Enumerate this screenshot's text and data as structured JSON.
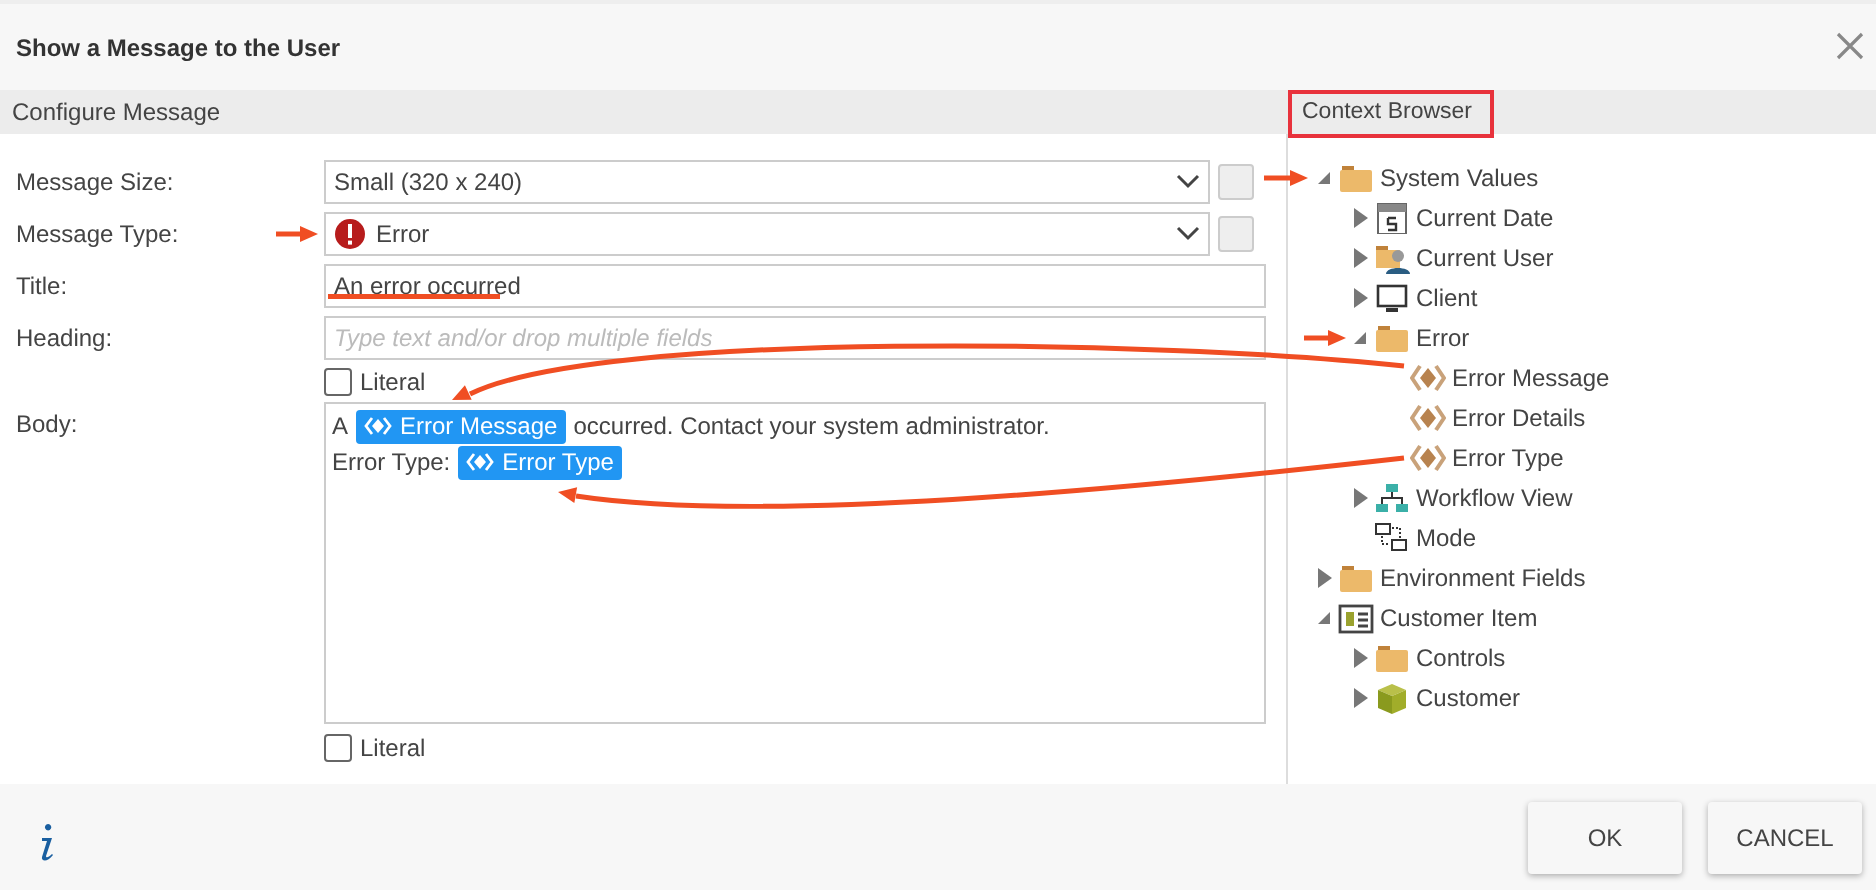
{
  "window": {
    "title": "Show a Message to the User"
  },
  "configure": {
    "heading": "Configure Message",
    "fields": [
      {
        "kind": "select",
        "label": "Message Size:",
        "value": "Small (320 x 240)"
      },
      {
        "kind": "select",
        "label": "Message Type:",
        "value": "Error",
        "status_icon": true
      },
      {
        "kind": "text",
        "label": "Title:",
        "value": "An error occurred"
      },
      {
        "kind": "text",
        "label": "Heading:",
        "placeholder": "Type text and/or drop multiple fields",
        "literal": {
          "label": "Literal",
          "checked": false
        }
      },
      {
        "kind": "body",
        "label": "Body:",
        "lines": [
          [
            {
              "kind": "text",
              "text": "A"
            },
            {
              "kind": "field",
              "text": "Error Message"
            },
            {
              "kind": "text",
              "text": "occurred. Contact your system administrator."
            }
          ],
          [
            {
              "kind": "text",
              "text": "Error Type:"
            },
            {
              "kind": "field",
              "text": "Error Type"
            }
          ]
        ],
        "literal": {
          "label": "Literal",
          "checked": false
        }
      }
    ]
  },
  "context_browser": {
    "heading": "Context Browser",
    "tree": [
      {
        "label": "System Values",
        "kind": "folder",
        "expanded": true,
        "children": [
          {
            "label": "Current Date",
            "kind": "date",
            "expanded": false
          },
          {
            "label": "Current User",
            "kind": "user",
            "expanded": false
          },
          {
            "label": "Client",
            "kind": "client",
            "expanded": false
          },
          {
            "label": "Error",
            "kind": "folder",
            "expanded": true,
            "children": [
              {
                "label": "Error Message",
                "kind": "field"
              },
              {
                "label": "Error Details",
                "kind": "field"
              },
              {
                "label": "Error Type",
                "kind": "field"
              }
            ]
          },
          {
            "label": "Workflow View",
            "kind": "view",
            "expanded": false
          },
          {
            "label": "Mode",
            "kind": "mode"
          }
        ]
      },
      {
        "label": "Environment Fields",
        "kind": "folder",
        "expanded": false
      },
      {
        "label": "Customer Item",
        "kind": "item",
        "expanded": true,
        "children": [
          {
            "label": "Controls",
            "kind": "folder",
            "expanded": false
          },
          {
            "label": "Customer",
            "kind": "entity",
            "expanded": false
          }
        ]
      }
    ]
  },
  "buttons": [
    "OK",
    "CANCEL"
  ]
}
